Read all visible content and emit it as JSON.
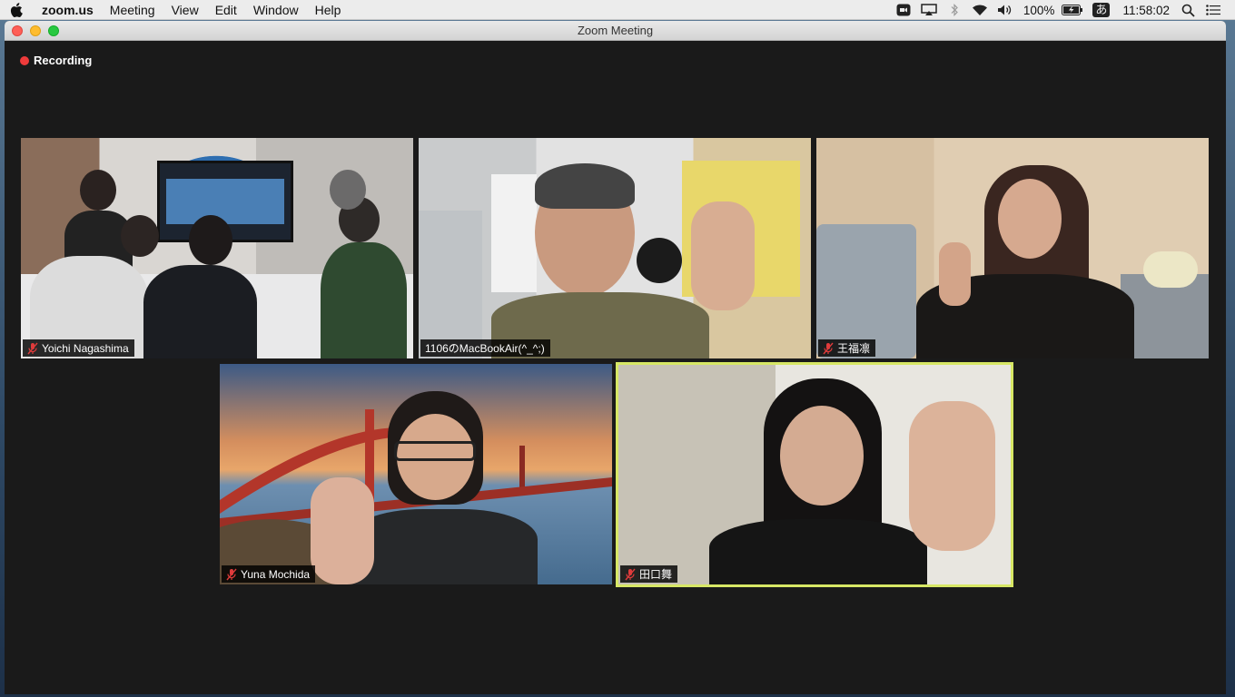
{
  "menubar": {
    "app_name": "zoom.us",
    "menus": [
      "Meeting",
      "View",
      "Edit",
      "Window",
      "Help"
    ],
    "battery": "100%",
    "input_method": "あ",
    "clock": "11:58:02"
  },
  "window": {
    "title": "Zoom Meeting"
  },
  "recording": {
    "label": "Recording"
  },
  "participants": [
    {
      "name": "Yoichi Nagashima",
      "muted": true
    },
    {
      "name": "1106のMacBookAir(^_^;)",
      "muted": false
    },
    {
      "name": "王福凛",
      "muted": true
    },
    {
      "name": "Yuna Mochida",
      "muted": true
    },
    {
      "name": "田口舞",
      "muted": true,
      "active_speaker": true
    }
  ],
  "colors": {
    "recording_dot": "#ef3b3b",
    "active_speaker_border": "#d7e765",
    "mute_icon": "#e03b3b",
    "meeting_background": "#1a1a1a"
  }
}
